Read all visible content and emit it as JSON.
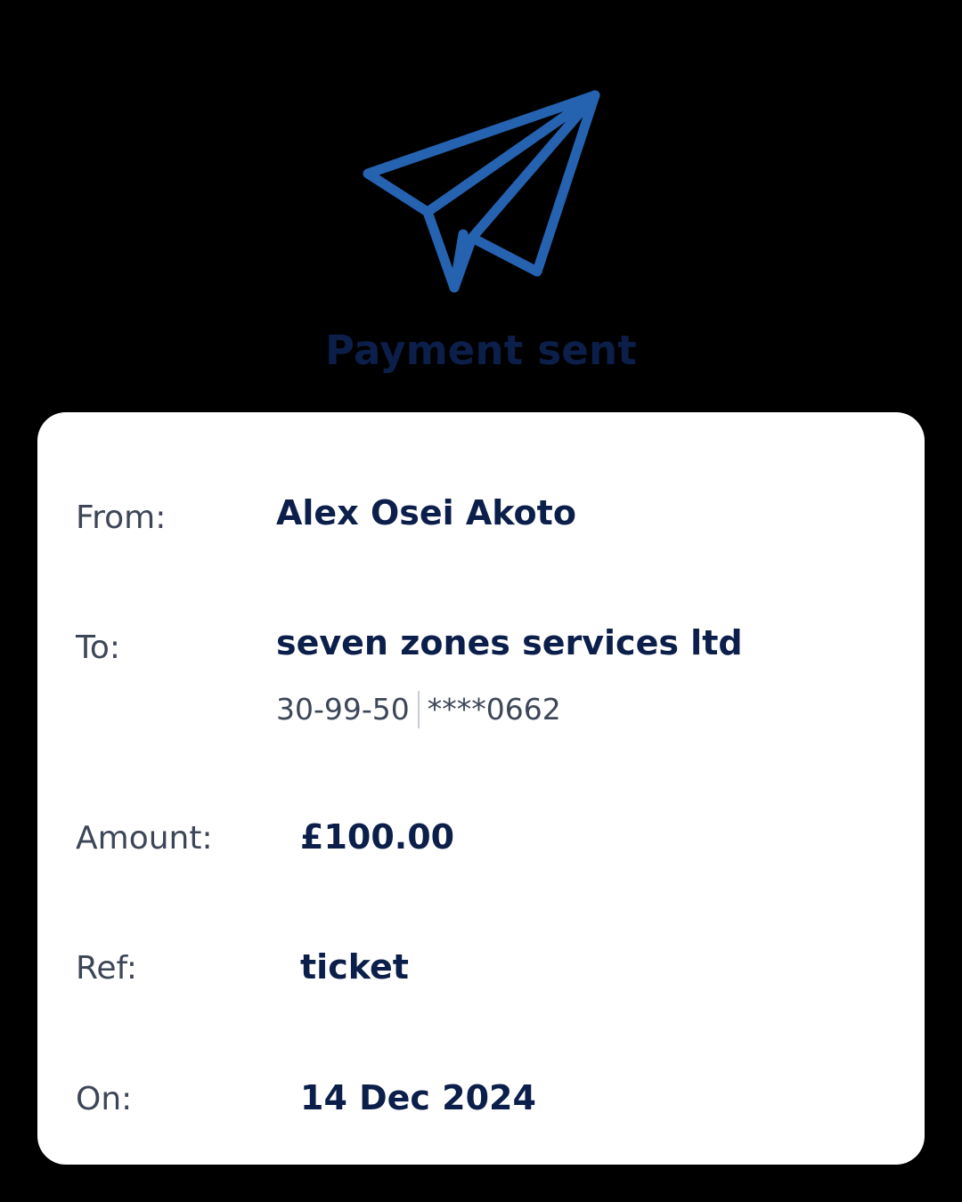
{
  "header": {
    "icon": "paper-plane-icon",
    "title": "Payment sent",
    "accent_color": "#2562b0",
    "title_color": "#0c1f4a"
  },
  "details": {
    "from": {
      "label": "From:",
      "value": "Alex Osei Akoto"
    },
    "to": {
      "label": "To:",
      "value": "seven zones services ltd",
      "sort_code": "30-99-50",
      "account_number": "****0662"
    },
    "amount": {
      "label": "Amount:",
      "value": "£100.00"
    },
    "ref": {
      "label": "Ref:",
      "value": "ticket"
    },
    "on": {
      "label": "On:",
      "value": "14 Dec 2024"
    }
  }
}
